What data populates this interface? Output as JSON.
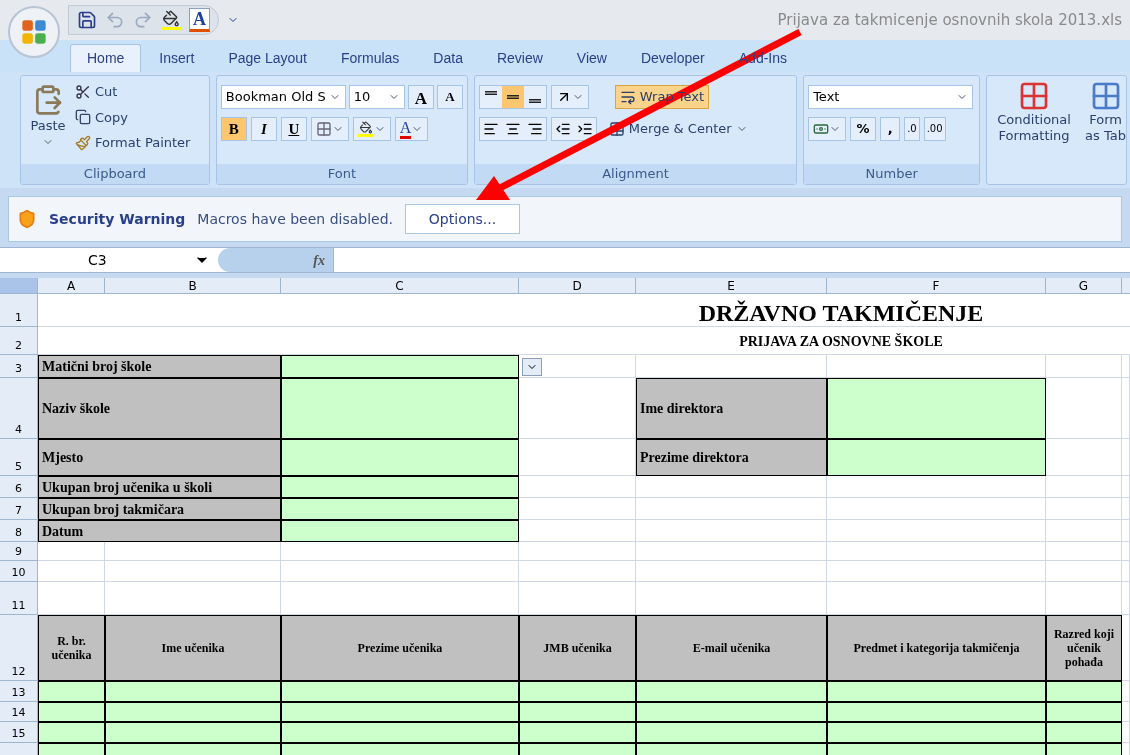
{
  "window": {
    "title": "Prijava za takmicenje osnovnih skola 2013.xls"
  },
  "quick_access": {
    "font_color_letter": "A"
  },
  "tabs": [
    {
      "label": "Home",
      "selected": true
    },
    {
      "label": "Insert",
      "selected": false
    },
    {
      "label": "Page Layout",
      "selected": false
    },
    {
      "label": "Formulas",
      "selected": false
    },
    {
      "label": "Data",
      "selected": false
    },
    {
      "label": "Review",
      "selected": false
    },
    {
      "label": "View",
      "selected": false
    },
    {
      "label": "Developer",
      "selected": false
    },
    {
      "label": "Add-Ins",
      "selected": false
    }
  ],
  "clipboard": {
    "label": "Clipboard",
    "paste": "Paste",
    "cut": "Cut",
    "copy": "Copy",
    "format_painter": "Format Painter"
  },
  "font": {
    "label": "Font",
    "font_name": "Bookman Old S",
    "font_size": "10",
    "grow": "A",
    "shrink": "A",
    "font_color": "A",
    "styles": [
      {
        "label": "B",
        "kind": "bold",
        "selected": true
      },
      {
        "label": "I",
        "kind": "italic",
        "selected": false
      },
      {
        "label": "U",
        "kind": "underline",
        "selected": false
      }
    ]
  },
  "alignment": {
    "label": "Alignment",
    "vertical": [
      {
        "kind": "top",
        "selected": false
      },
      {
        "kind": "middle",
        "selected": true
      },
      {
        "kind": "bottom",
        "selected": false
      }
    ],
    "horizontal": [
      {
        "kind": "left",
        "selected": false
      },
      {
        "kind": "center",
        "selected": false
      },
      {
        "kind": "right",
        "selected": false
      }
    ],
    "wrap_text": {
      "label": "Wrap Text",
      "on": true
    },
    "merge": "Merge & Center"
  },
  "number": {
    "label": "Number",
    "format": "Text",
    "percent": "%",
    "comma": ",",
    "decimals": [
      ".0",
      ".00"
    ]
  },
  "styles": {
    "conditional": "Conditional Formatting",
    "format_table": [
      "Form",
      "as Tab"
    ]
  },
  "security": {
    "title": "Security Warning",
    "message": "Macros have been disabled.",
    "button": "Options..."
  },
  "formula_bar": {
    "name_box": "C3",
    "fx": "fx"
  },
  "sheet": {
    "column_letters": [
      "A",
      "B",
      "C",
      "D",
      "E",
      "F",
      "G"
    ],
    "row_numbers": [
      "1",
      "2",
      "3",
      "4",
      "5",
      "6",
      "7",
      "8",
      "9",
      "10",
      "11",
      "12",
      "13",
      "14",
      "15"
    ],
    "title": "DRŽAVNO TAKMIČENJE",
    "subtitle": "PRIJAVA ZA OSNOVNE ŠKOLE",
    "school_fields": [
      "Matični broj škole",
      "Naziv škole",
      "Mjesto",
      "Ukupan broj učenika u školi",
      "Ukupan broj takmičara",
      "Datum"
    ],
    "director_fields": [
      "Ime direktora",
      "Prezime direktora"
    ],
    "table_columns": [
      "R. br. učenika",
      "Ime učenika",
      "Prezime učenika",
      "JMB učenika",
      "E-mail učenika",
      "Predmet i kategorija takmičenja",
      "Razred koji učenik pohađa"
    ]
  }
}
